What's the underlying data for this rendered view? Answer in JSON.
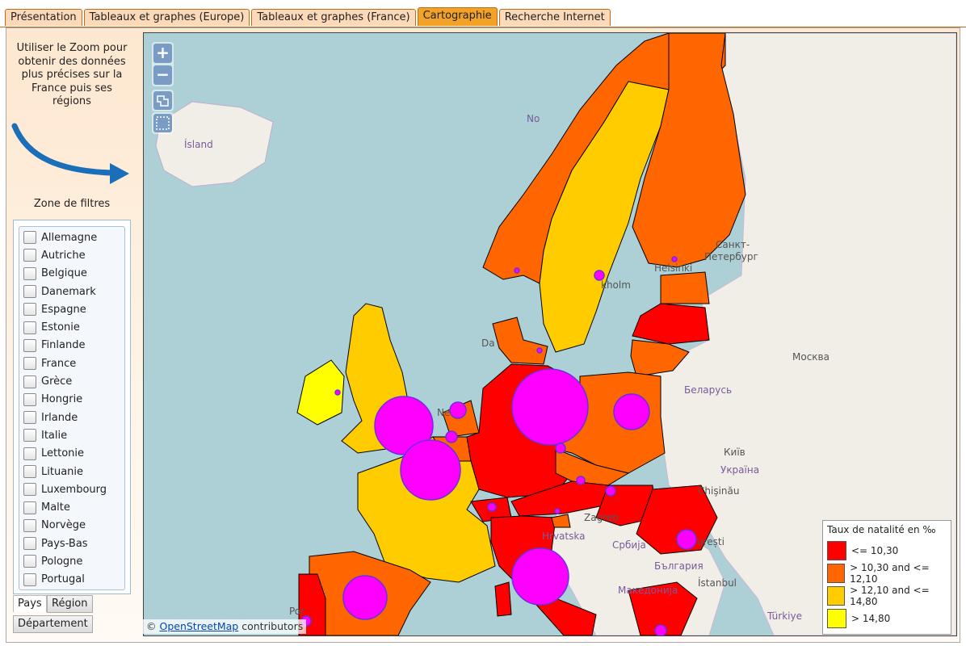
{
  "tabs": [
    {
      "label": "Présentation",
      "active": false
    },
    {
      "label": "Tableaux et graphes (Europe)",
      "active": false
    },
    {
      "label": "Tableaux et graphes (France)",
      "active": false
    },
    {
      "label": "Cartographie",
      "active": true
    },
    {
      "label": "Recherche Internet",
      "active": false
    }
  ],
  "sidebar": {
    "hint_lines": [
      "Utiliser le Zoom pour",
      "obtenir des données",
      "plus précises sur la",
      "France puis ses",
      "régions"
    ],
    "filters_title": "Zone de filtres",
    "countries": [
      "Allemagne",
      "Autriche",
      "Belgique",
      "Danemark",
      "Espagne",
      "Estonie",
      "Finlande",
      "France",
      "Grèce",
      "Hongrie",
      "Irlande",
      "Italie",
      "Lettonie",
      "Lituanie",
      "Luxembourg",
      "Malte",
      "Norvège",
      "Pays-Bas",
      "Pologne",
      "Portugal"
    ],
    "level_buttons": {
      "pays": "Pays",
      "region": "Région",
      "departement": "Département"
    }
  },
  "map": {
    "zoom_in": "+",
    "zoom_out": "−",
    "place_labels": {
      "island": "Ísland",
      "norway": "No",
      "stpetersburg_1": "Санкт-",
      "stpetersburg_2": "Петербург",
      "helsinki": "Helsinki",
      "stockholm": "kholm",
      "moscow": "Москва",
      "belarus": "Беларусь",
      "kyiv": "Київ",
      "ukraine": "Україна",
      "chisinau": "Chişinău",
      "zagreb": "Zagreb",
      "hrvatska": "Hrvatska",
      "srbija": "Србија",
      "bucuresti": "urești",
      "bulgaria": "България",
      "istanbul": "İstanbul",
      "makedonija": "Македонија",
      "turkiye": "Türkiye",
      "nederland": "Ne",
      "danmark": "Da",
      "portugal": "Por"
    },
    "colors": {
      "c1": "#ff0000",
      "c2": "#ff6600",
      "c3": "#ffcc00",
      "c4": "#ffff00",
      "bubble": "#ff00ff"
    },
    "attribution_prefix": "© ",
    "attribution_link": "OpenStreetMap",
    "attribution_suffix": " contributors"
  },
  "legend": {
    "title": "Taux de natalité en ‰",
    "classes": [
      {
        "label": "<= 10,30",
        "color": "#ff0000"
      },
      {
        "label": "> 10,30 and <= 12,10",
        "color": "#ff6600"
      },
      {
        "label": "> 12,10 and <= 14,80",
        "color": "#ffcc00"
      },
      {
        "label": "> 14,80",
        "color": "#ffff00"
      }
    ]
  }
}
